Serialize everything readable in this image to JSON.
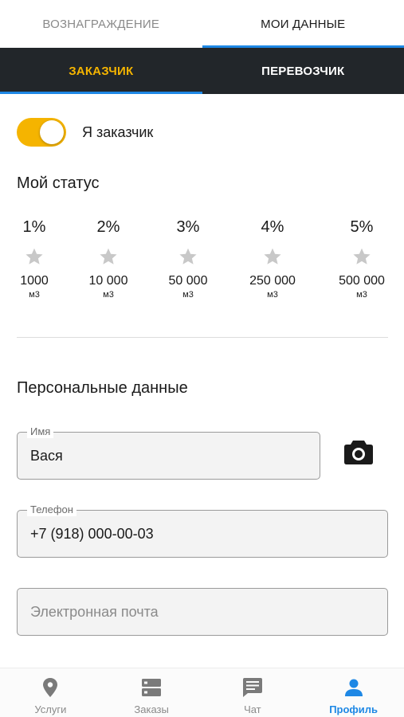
{
  "top_tabs": [
    {
      "label": "ВОЗНАГРАЖДЕНИЕ",
      "active": false
    },
    {
      "label": "МОИ ДАННЫЕ",
      "active": true
    }
  ],
  "sub_tabs": [
    {
      "label": "ЗАКАЗЧИК",
      "active": true
    },
    {
      "label": "ПЕРЕВОЗЧИК",
      "active": false
    }
  ],
  "customer_toggle": {
    "label": "Я заказчик",
    "on": true
  },
  "status": {
    "title": "Мой статус",
    "levels": [
      {
        "percent": "1%",
        "amount": "1000",
        "unit": "м3"
      },
      {
        "percent": "2%",
        "amount": "10 000",
        "unit": "м3"
      },
      {
        "percent": "3%",
        "amount": "50 000",
        "unit": "м3"
      },
      {
        "percent": "4%",
        "amount": "250 000",
        "unit": "м3"
      },
      {
        "percent": "5%",
        "amount": "500 000",
        "unit": "м3"
      }
    ]
  },
  "personal": {
    "title": "Персональные данные",
    "name": {
      "label": "Имя",
      "value": "Вася"
    },
    "phone": {
      "label": "Телефон",
      "value": "+7 (918) 000-00-03"
    },
    "email": {
      "placeholder": "Электронная почта"
    }
  },
  "bottom_nav": [
    {
      "label": "Услуги",
      "icon": "location-pin-icon",
      "active": false
    },
    {
      "label": "Заказы",
      "icon": "orders-list-icon",
      "active": false
    },
    {
      "label": "Чат",
      "icon": "chat-bubble-icon",
      "active": false
    },
    {
      "label": "Профиль",
      "icon": "person-icon",
      "active": true
    }
  ],
  "colors": {
    "accent_yellow": "#f5b400",
    "accent_blue": "#1e88e5",
    "dark_bar": "#22262a",
    "star_inactive": "#c8c8c8"
  }
}
